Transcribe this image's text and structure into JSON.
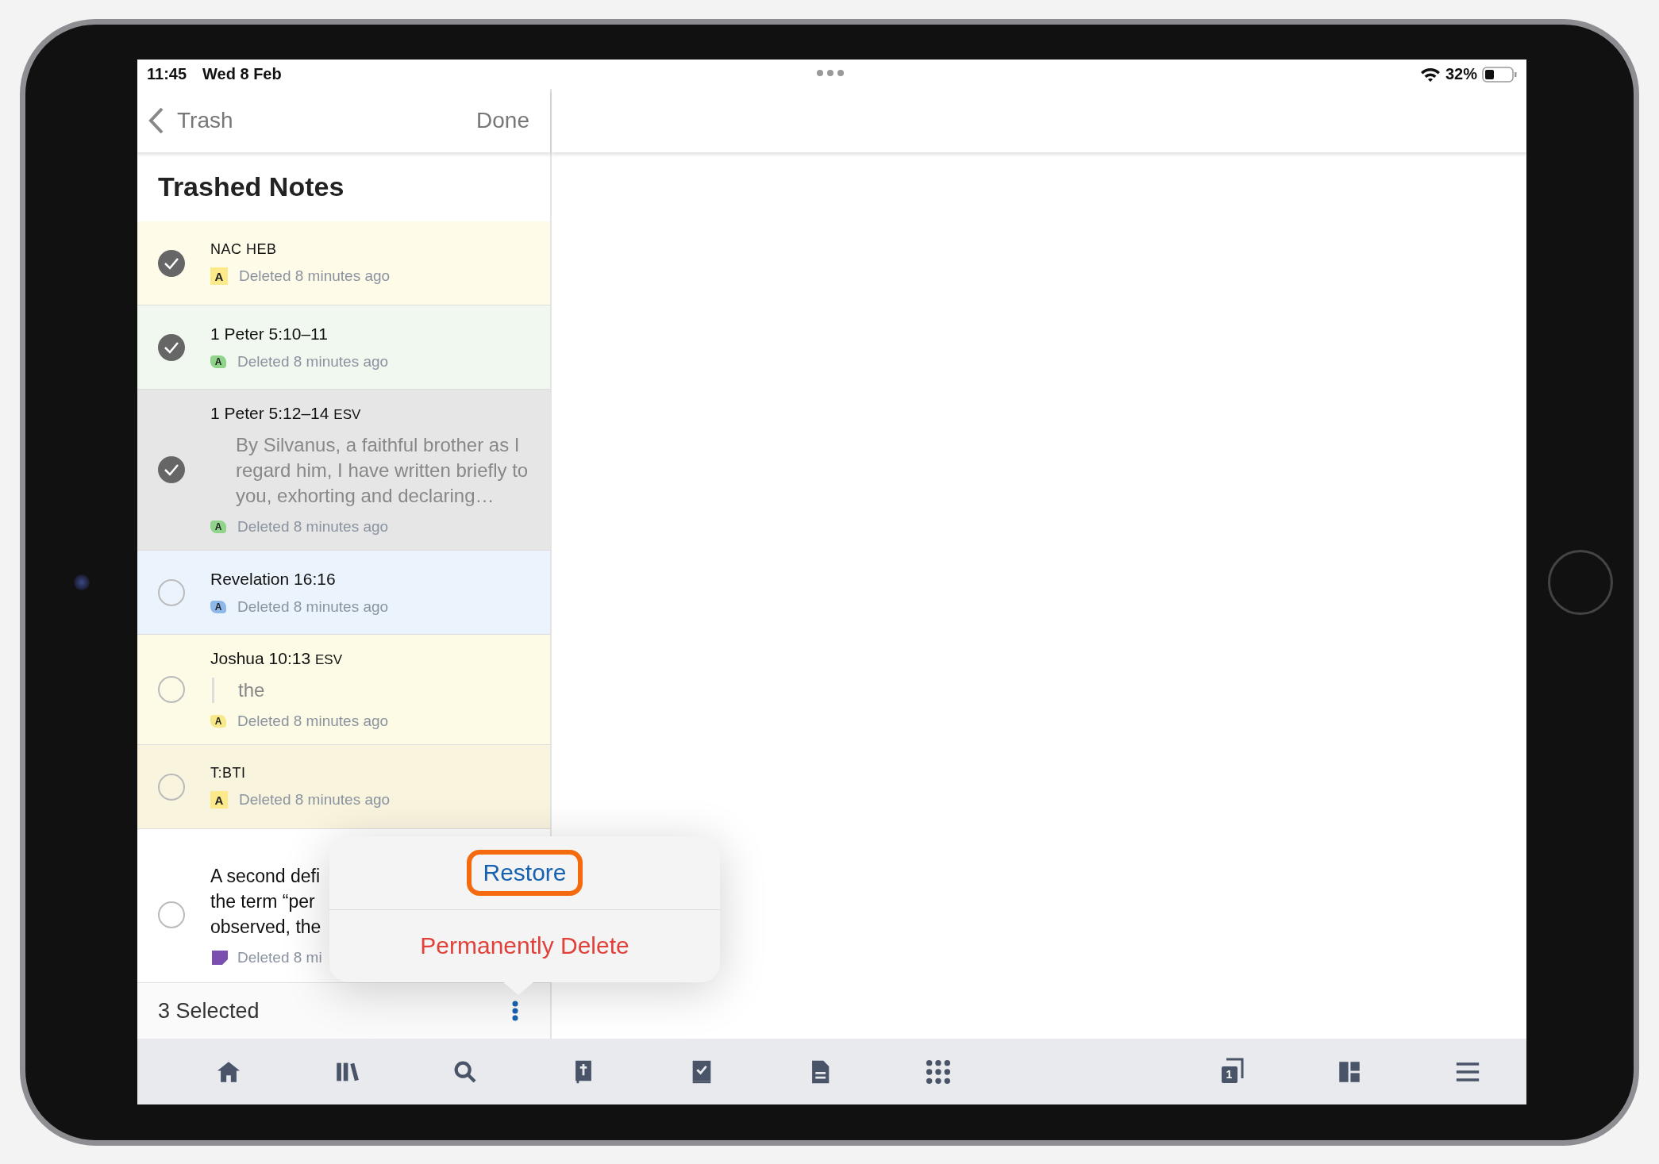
{
  "status_bar": {
    "time": "11:45",
    "date": "Wed 8 Feb",
    "battery": "32%"
  },
  "nav": {
    "back": "Trash",
    "done": "Done"
  },
  "list": {
    "title": "Trashed Notes",
    "notes": [
      {
        "kind": "resource",
        "title": "NAC HEB",
        "selected": true,
        "color": "#fffbe9",
        "marker": {
          "kind": "square",
          "label": "A",
          "color": "#fbe98a"
        },
        "meta": "Deleted 8 minutes ago"
      },
      {
        "kind": "passage",
        "title": "1 Peter 5:10–11",
        "selected": true,
        "color": "#f1f8ef",
        "marker": {
          "kind": "highlight",
          "label": "A",
          "color": "#8fd48a"
        },
        "meta": "Deleted 8 minutes ago"
      },
      {
        "kind": "passage",
        "title": "1 Peter 5:12–14",
        "version": "ESV",
        "snippet": "By Silvanus, a faithful brother as I regard him, I have written briefly to you, exhorting and declaring…",
        "quoted": false,
        "selected": true,
        "color": "#e6e6e6",
        "marker": {
          "kind": "highlight",
          "label": "A",
          "color": "#8fd48a"
        },
        "meta": "Deleted 8 minutes ago"
      },
      {
        "kind": "passage",
        "title": "Revelation 16:16",
        "selected": false,
        "color": "#ebf4fd",
        "marker": {
          "kind": "highlight",
          "label": "A",
          "color": "#8fb8ea"
        },
        "meta": "Deleted 8 minutes ago"
      },
      {
        "kind": "passage",
        "title": "Joshua 10:13",
        "version": "ESV",
        "snippet": "the",
        "quoted": true,
        "selected": false,
        "color": "#fdfae6",
        "marker": {
          "kind": "highlight",
          "label": "A",
          "color": "#f7e98a"
        },
        "meta": "Deleted 8 minutes ago"
      },
      {
        "kind": "resource",
        "title": "T:BTI",
        "selected": false,
        "color": "#f8f4de",
        "marker": {
          "kind": "square",
          "label": "A",
          "color": "#fbe98a"
        },
        "meta": "Deleted 8 minutes ago"
      },
      {
        "kind": "text",
        "lines": [
          "A second defi",
          "the term “per",
          "observed, the"
        ],
        "selected": false,
        "color": "#ffffff",
        "marker": {
          "kind": "note",
          "color": "#7b4fb0"
        },
        "meta": "Deleted 8 mi"
      }
    ]
  },
  "footer": {
    "count": "3 Selected"
  },
  "menu": {
    "items": [
      {
        "label": "Restore",
        "kind": "action",
        "highlighted": true
      },
      {
        "label": "Permanently Delete",
        "kind": "destructive",
        "highlighted": false
      }
    ]
  },
  "toolbar": {
    "left": [
      {
        "kind": "home"
      },
      {
        "kind": "library"
      },
      {
        "kind": "search"
      },
      {
        "kind": "bible"
      },
      {
        "kind": "plans"
      },
      {
        "kind": "document"
      },
      {
        "kind": "apps"
      }
    ],
    "right": [
      {
        "kind": "tabs",
        "badge": "1"
      },
      {
        "kind": "layout"
      },
      {
        "kind": "menu"
      }
    ]
  }
}
